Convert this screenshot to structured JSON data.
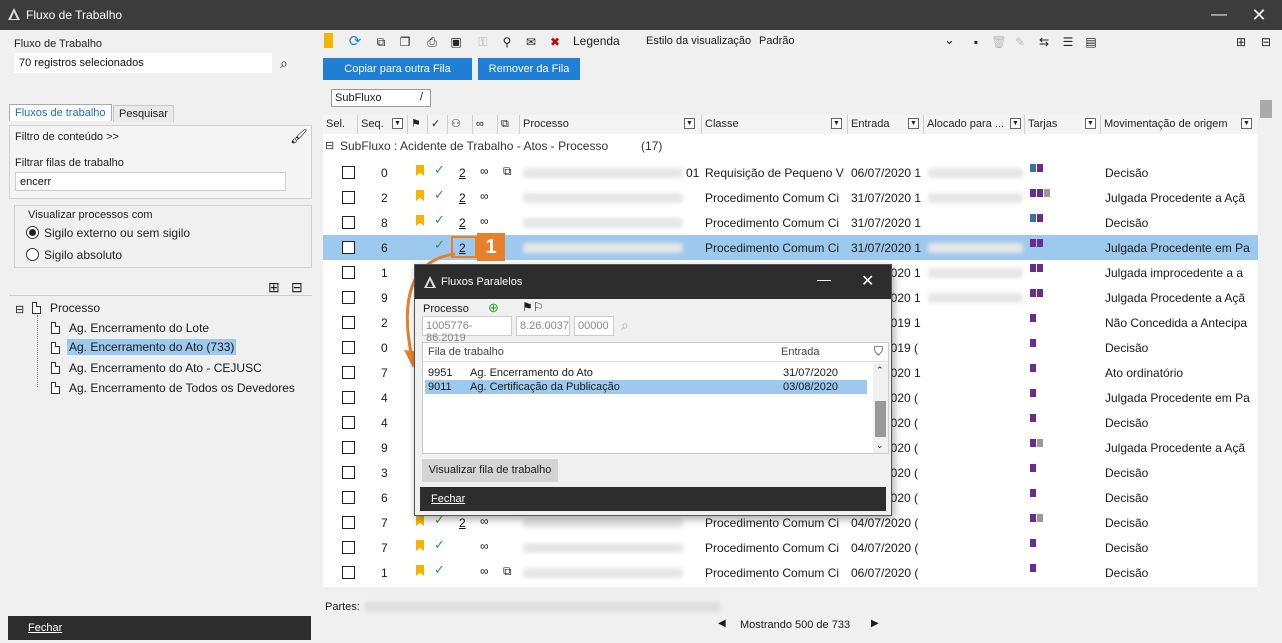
{
  "window": {
    "title": "Fluxo de Trabalho"
  },
  "left": {
    "workflow_label": "Fluxo de Trabalho",
    "workflow_value": "70 registros selecionados",
    "tabs": [
      "Fluxos de trabalho",
      "Pesquisar"
    ],
    "content_filter": "Filtro de conteúdo >>",
    "filter_label": "Filtrar filas de trabalho",
    "filter_value": "encerr",
    "visualize_label": "Visualizar processos com",
    "radio1": "Sigilo externo ou sem sigilo",
    "radio2": "Sigilo absoluto",
    "tree_root": "Processo",
    "tree_items": [
      "Ag. Encerramento do Lote",
      "Ag. Encerramento do Ato (733)",
      "Ag. Encerramento do Ato - CEJUSC",
      "Ag. Encerramento de Todos os Devedores"
    ],
    "close": "Fechar"
  },
  "toolbar": {
    "legend": "Legenda",
    "view_style_label": "Estilo da visualização",
    "view_style_value": "Padrão",
    "copy_btn": "Copiar para outra Fila",
    "remove_btn": "Remover da Fila",
    "group_chip": "SubFluxo"
  },
  "grid": {
    "headers": {
      "sel": "Sel.",
      "seq": "Seq.",
      "processo": "Processo",
      "classe": "Classe",
      "entrada": "Entrada",
      "alocado": "Alocado para ...",
      "tarjas": "Tarjas",
      "mov": "Movimentação de origem"
    },
    "group_label": "SubFluxo : Acidente de Trabalho - Atos - Processo",
    "group_count": "(17)",
    "rows": [
      {
        "seq": "0",
        "n": "2",
        "proc_tail": "01",
        "classe": "Requisição de Pequeno V",
        "entrada": "06/07/2020 1",
        "mov": "Decisão"
      },
      {
        "seq": "2",
        "n": "2",
        "classe": "Procedimento Comum Ci",
        "entrada": "31/07/2020 1",
        "mov": "Julgada Procedente a Açã"
      },
      {
        "seq": "8",
        "n": "2",
        "classe": "Procedimento Comum Ci",
        "entrada": "31/07/2020 1",
        "mov": "Decisão"
      },
      {
        "seq": "6",
        "n": "2",
        "classe": "Procedimento Comum Ci",
        "entrada": "31/07/2020 1",
        "mov": "Julgada Procedente em Pa"
      },
      {
        "seq": "1",
        "n": "",
        "classe": "",
        "entrada": "2020 1",
        "mov": "Julgada improcedente a a"
      },
      {
        "seq": "9",
        "n": "",
        "classe": "",
        "entrada": "2020 1",
        "mov": "Julgada Procedente a Açã"
      },
      {
        "seq": "2",
        "n": "",
        "classe": "",
        "entrada": "2019 1",
        "mov": "Não Concedida a Antecipa"
      },
      {
        "seq": "0",
        "n": "",
        "classe": "",
        "entrada": "2019 (",
        "mov": "Decisão"
      },
      {
        "seq": "7",
        "n": "",
        "classe": "",
        "entrada": "2020 1",
        "mov": "Ato ordinatório"
      },
      {
        "seq": "4",
        "n": "",
        "classe": "",
        "entrada": "2020 (",
        "mov": "Julgada Procedente em Pa"
      },
      {
        "seq": "4",
        "n": "",
        "classe": "",
        "entrada": "2020 (",
        "mov": "Decisão"
      },
      {
        "seq": "9",
        "n": "",
        "classe": "",
        "entrada": "2020 (",
        "mov": "Julgada Procedente a Açã"
      },
      {
        "seq": "3",
        "n": "",
        "classe": "",
        "entrada": "2020 (",
        "mov": "Decisão"
      },
      {
        "seq": "6",
        "n": "",
        "classe": "",
        "entrada": "2020 (",
        "mov": "Decisão"
      },
      {
        "seq": "7",
        "n": "2",
        "classe": "Procedimento Comum Ci",
        "entrada": "04/07/2020 (",
        "mov": "Decisão"
      },
      {
        "seq": "7",
        "n": "",
        "classe": "Procedimento Comum Ci",
        "entrada": "04/07/2020 (",
        "mov": "Decisão"
      },
      {
        "seq": "1",
        "n": "",
        "classe": "Procedimento Comum Ci",
        "entrada": "06/07/2020 (",
        "mov": "Decisão"
      }
    ]
  },
  "footer": {
    "partes": "Partes:",
    "showing": "Mostrando 500 de 733"
  },
  "popup": {
    "title": "Fluxos Paralelos",
    "processo_label": "Processo",
    "num1": "1005776-86.2019",
    "num2": "8.26.0037",
    "num3": "00000",
    "col1": "Fila de trabalho",
    "col2": "Entrada",
    "rows": [
      {
        "code": "9951",
        "name": "Ag. Encerramento do Ato",
        "date": "31/07/2020"
      },
      {
        "code": "9011",
        "name": "Ag. Certificação da Publicação",
        "date": "03/08/2020"
      }
    ],
    "view_btn": "Visualizar fila de trabalho",
    "close": "Fechar"
  },
  "badge": "1",
  "colors": {
    "accent": "#1e7fd4",
    "selection": "#9ec9ee",
    "callout": "#e8802a",
    "tag_purple": "#6b2c8f",
    "tag_blue": "#3a6fb0"
  }
}
